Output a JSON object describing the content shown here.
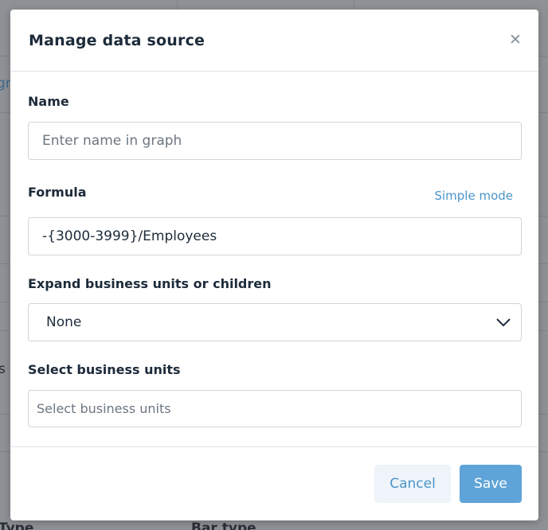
{
  "backdrop": {
    "left_link_fragment": "gr",
    "left_text_fragment": "s",
    "bottom_left_text": "Type",
    "bottom_mid_text": "Bar type"
  },
  "modal": {
    "title": "Manage data source",
    "close_icon": "close-icon",
    "name": {
      "label": "Name",
      "value": "",
      "placeholder": "Enter name in graph"
    },
    "formula": {
      "label": "Formula",
      "mode_link": "Simple mode",
      "value": "-{3000-3999}/Employees"
    },
    "expand": {
      "label": "Expand business units or children",
      "selected": "None"
    },
    "business_units": {
      "label": "Select business units",
      "placeholder": "Select business units"
    },
    "footer": {
      "cancel_label": "Cancel",
      "save_label": "Save"
    }
  },
  "colors": {
    "accent": "#4a95c9",
    "save_bg": "#5fa4d8",
    "cancel_bg": "#eef4f9",
    "overlay": "#8e9195"
  }
}
